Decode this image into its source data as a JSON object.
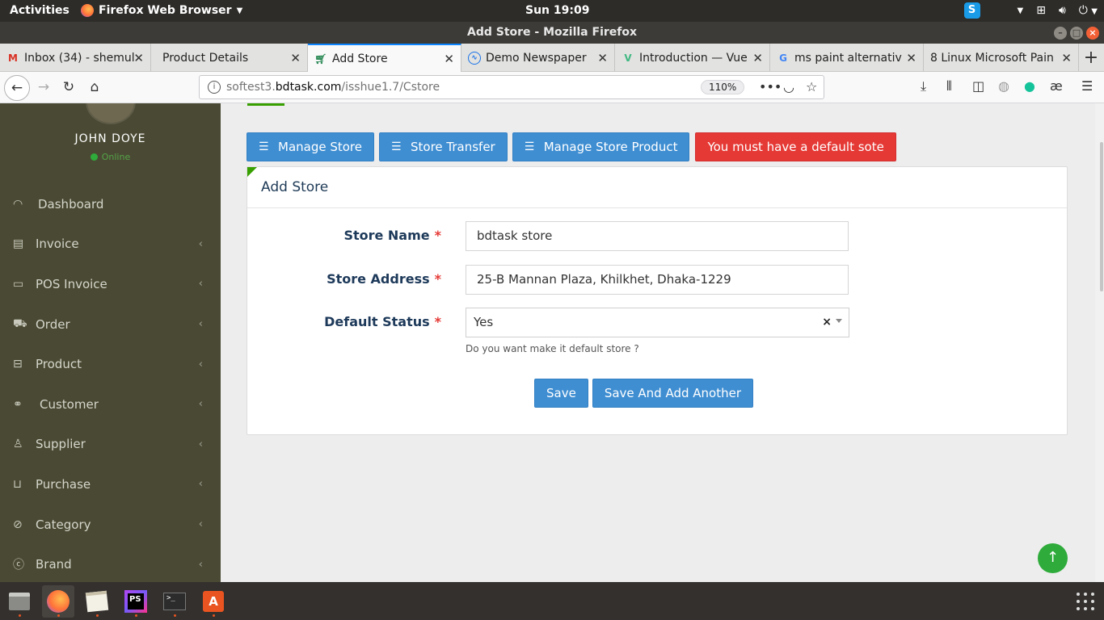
{
  "system": {
    "activities": "Activities",
    "app_menu": "Firefox Web Browser",
    "clock": "Sun 19:09",
    "skype_letter": "S"
  },
  "window": {
    "title": "Add Store - Mozilla Firefox"
  },
  "tabs": [
    {
      "label": "Inbox (34) - shemul",
      "icon": "gmail-icon",
      "color": "#d93025"
    },
    {
      "label": "Product Details",
      "icon": "",
      "color": ""
    },
    {
      "label": "Add Store",
      "icon": "cart-icon",
      "color": "#2e8b57",
      "active": true
    },
    {
      "label": "Demo Newspaper",
      "icon": "pulse-icon",
      "color": "#1a73e8"
    },
    {
      "label": "Introduction — Vue",
      "icon": "vue-icon",
      "color": "#41b883"
    },
    {
      "label": "ms paint alternativ",
      "icon": "google-icon",
      "color": "#4285f4"
    },
    {
      "label": "8 Linux Microsoft Pain",
      "icon": "",
      "color": ""
    }
  ],
  "navbar": {
    "url_host": "softest3.",
    "url_domain": "bdtask.com",
    "url_path": "/isshue1.7/Cstore",
    "zoom": "110%"
  },
  "sidebar": {
    "user_name": "JOHN DOYE",
    "status": "Online",
    "items": [
      {
        "label": "Dashboard",
        "icon": "dashboard-icon",
        "submenu": false
      },
      {
        "label": "Invoice",
        "icon": "invoice-icon",
        "submenu": true
      },
      {
        "label": "POS Invoice",
        "icon": "pos-icon",
        "submenu": true
      },
      {
        "label": "Order",
        "icon": "truck-icon",
        "submenu": true
      },
      {
        "label": "Product",
        "icon": "bag-icon",
        "submenu": true
      },
      {
        "label": "Customer",
        "icon": "handshake-icon",
        "submenu": true
      },
      {
        "label": "Supplier",
        "icon": "user-icon",
        "submenu": true
      },
      {
        "label": "Purchase",
        "icon": "cart-icon",
        "submenu": true
      },
      {
        "label": "Category",
        "icon": "tag-icon",
        "submenu": true
      },
      {
        "label": "Brand",
        "icon": "apple-icon",
        "submenu": true
      }
    ]
  },
  "toolbar": {
    "manage_store": "Manage Store",
    "store_transfer": "Store Transfer",
    "manage_store_product": "Manage Store Product",
    "default_warning": "You must have a default sote"
  },
  "form": {
    "title": "Add Store",
    "store_name_label": "Store Name",
    "store_name_value": "bdtask store",
    "store_address_label": "Store Address",
    "store_address_value": "25-B Mannan Plaza, Khilkhet, Dhaka-1229",
    "default_status_label": "Default Status",
    "default_status_value": "Yes",
    "required_mark": "*",
    "hint": "Do you want make it default store ?",
    "save": "Save",
    "save_add_another": "Save And Add Another"
  },
  "colors": {
    "sidebar_bg": "#4a4a34",
    "primary": "#3f8ed2",
    "danger": "#e53935",
    "accent_green": "#2eab3a"
  }
}
